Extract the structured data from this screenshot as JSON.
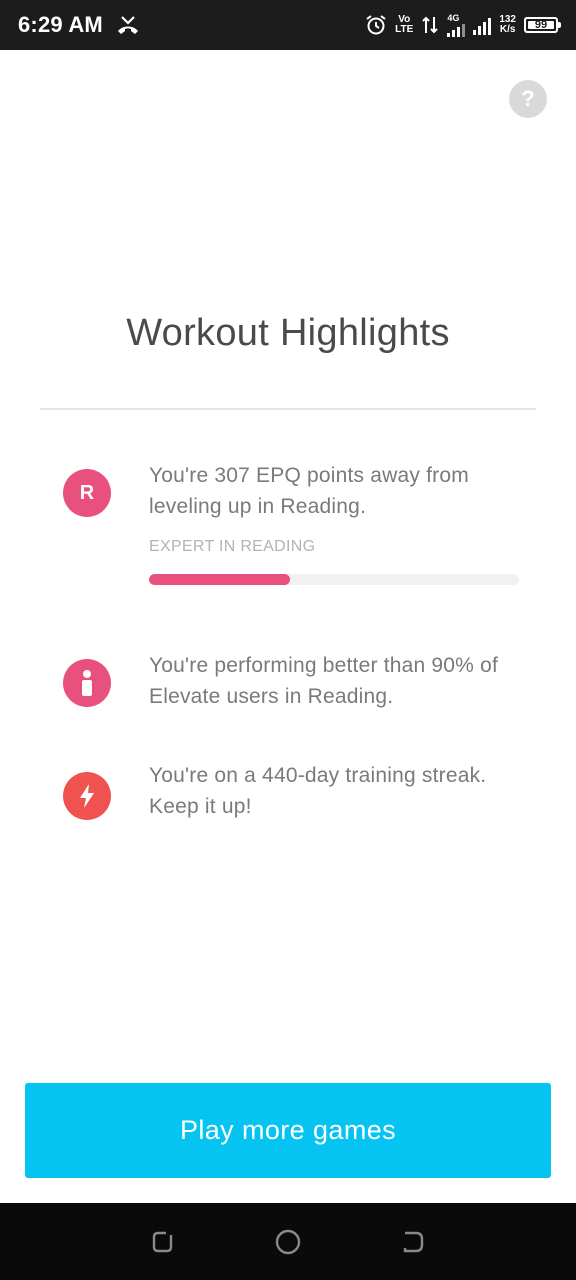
{
  "status_bar": {
    "time": "6:29 AM",
    "volte_top": "Vo",
    "volte_bottom": "LTE",
    "network_type": "4G",
    "speed_value": "132",
    "speed_unit": "K/s",
    "battery": "99",
    "icons": [
      "missed-call-icon",
      "alarm-icon",
      "data-arrows-icon",
      "signal-icon",
      "battery-icon"
    ]
  },
  "header": {
    "help_label": "?"
  },
  "page": {
    "title": "Workout Highlights"
  },
  "highlights": [
    {
      "badge": "R",
      "badge_color": "#e8507d",
      "text": "You're 307 EPQ points away from leveling up in Reading.",
      "progress_label": "EXPERT IN READING",
      "progress_fraction": 0.38
    },
    {
      "badge_icon": "person-icon",
      "badge_color": "#e8507d",
      "text": "You're performing better than 90% of Elevate users in Reading."
    },
    {
      "badge_icon": "lightning-icon",
      "badge_color": "#f0524f",
      "text": "You're on a 440-day training streak. Keep it up!"
    }
  ],
  "cta": {
    "label": "Play more games",
    "color": "#06c4f2"
  },
  "nav_bar": {
    "icons": [
      "recent-apps-icon",
      "home-icon",
      "back-icon"
    ]
  }
}
